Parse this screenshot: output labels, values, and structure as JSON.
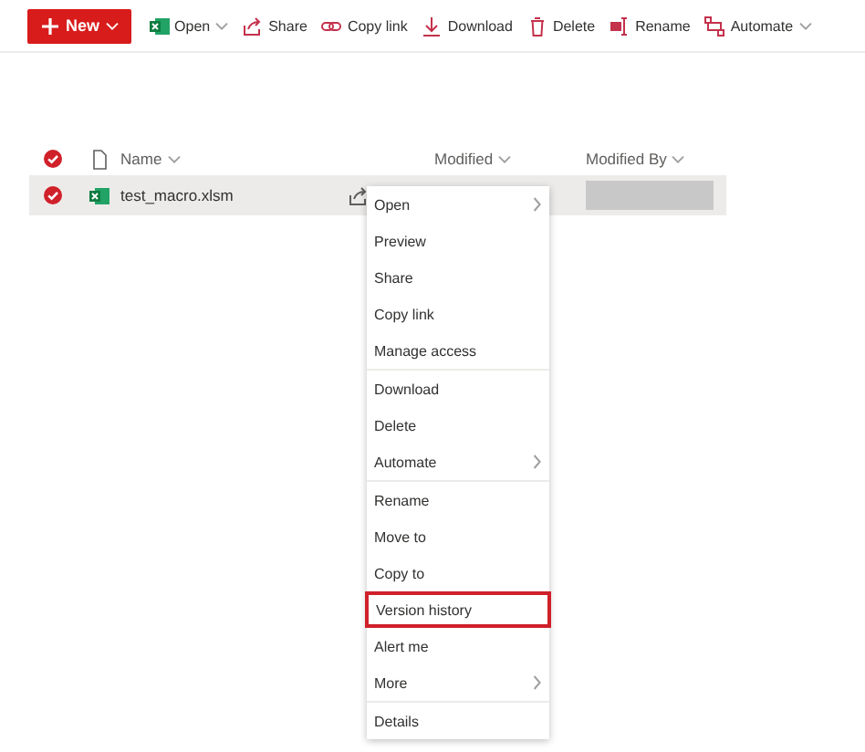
{
  "toolbar": [
    {
      "kind": "new",
      "label": "New",
      "dropdown": true
    },
    {
      "kind": "excel",
      "label": "Open",
      "dropdown": true
    },
    {
      "kind": "share",
      "label": "Share",
      "dropdown": false
    },
    {
      "kind": "link",
      "label": "Copy link",
      "dropdown": false
    },
    {
      "kind": "download",
      "label": "Download",
      "dropdown": false
    },
    {
      "kind": "delete",
      "label": "Delete",
      "dropdown": false
    },
    {
      "kind": "rename",
      "label": "Rename",
      "dropdown": false
    },
    {
      "kind": "automate",
      "label": "Automate",
      "dropdown": true
    }
  ],
  "columns": [
    {
      "label": "Name"
    },
    {
      "label": "Modified"
    },
    {
      "label": "Modified By"
    }
  ],
  "header_checked": true,
  "rows": [
    {
      "name": "test_macro.xlsm",
      "selected": true
    }
  ],
  "context_menu": {
    "groups": [
      [
        {
          "label": "Open",
          "submenu": true,
          "highlighted": false
        },
        {
          "label": "Preview",
          "submenu": false,
          "highlighted": false
        },
        {
          "label": "Share",
          "submenu": false,
          "highlighted": false
        },
        {
          "label": "Copy link",
          "submenu": false,
          "highlighted": false
        },
        {
          "label": "Manage access",
          "submenu": false,
          "highlighted": false
        }
      ],
      [
        {
          "label": "Download",
          "submenu": false,
          "highlighted": false
        },
        {
          "label": "Delete",
          "submenu": false,
          "highlighted": false
        },
        {
          "label": "Automate",
          "submenu": true,
          "highlighted": false
        }
      ],
      [
        {
          "label": "Rename",
          "submenu": false,
          "highlighted": false
        },
        {
          "label": "Move to",
          "submenu": false,
          "highlighted": false
        },
        {
          "label": "Copy to",
          "submenu": false,
          "highlighted": false
        },
        {
          "label": "Version history",
          "submenu": false,
          "highlighted": true
        },
        {
          "label": "Alert me",
          "submenu": false,
          "highlighted": false
        },
        {
          "label": "More",
          "submenu": true,
          "highlighted": false
        }
      ],
      [
        {
          "label": "Details",
          "submenu": false,
          "highlighted": false
        }
      ]
    ]
  }
}
